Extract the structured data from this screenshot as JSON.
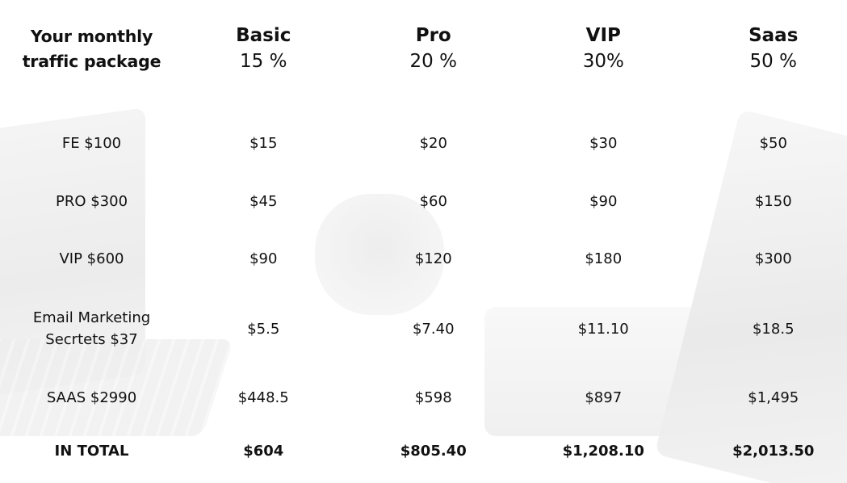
{
  "table": {
    "corner_label": "Your monthly traffic package",
    "plans": [
      {
        "name": "Basic",
        "percent": "15 %"
      },
      {
        "name": "Pro",
        "percent": "20 %"
      },
      {
        "name": "VIP",
        "percent": "30%"
      },
      {
        "name": "Saas",
        "percent": "50 %"
      }
    ],
    "rows": [
      {
        "label": "FE $100",
        "values": [
          "$15",
          "$20",
          "$30",
          "$50"
        ]
      },
      {
        "label": "PRO $300",
        "values": [
          "$45",
          "$60",
          "$90",
          "$150"
        ]
      },
      {
        "label": "VIP $600",
        "values": [
          "$90",
          "$120",
          "$180",
          "$300"
        ]
      },
      {
        "label": "Email Marketing Secrtets $37",
        "values": [
          "$5.5",
          "$7.40",
          "$11.10",
          "$18.5"
        ]
      },
      {
        "label": "SAAS $2990",
        "values": [
          "$448.5",
          "$598",
          "$897",
          "$1,495"
        ]
      }
    ],
    "total": {
      "label": "IN TOTAL",
      "values": [
        "$604",
        "$805.40",
        "$1,208.10",
        "$2,013.50"
      ]
    }
  }
}
